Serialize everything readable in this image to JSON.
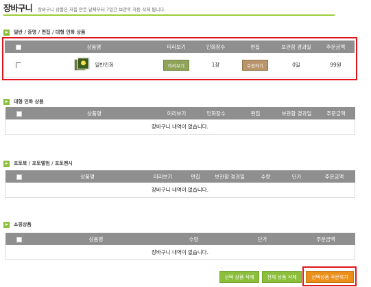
{
  "header": {
    "title": "장바구니",
    "description": "장바구니 상품은 처음 만든 날짜부터 7일간 보관후 자동 삭제 됩니다."
  },
  "colors": {
    "accent_green": "#8bbf3b",
    "table_header": "#8f8f8f",
    "highlight_red": "#e0141b",
    "order_orange": "#eb8f1b",
    "price_orange": "#e8862a"
  },
  "section1": {
    "title": "일반 / 증명 / 편집 / 대형 인화 상품",
    "columns": [
      "상품명",
      "미리보기",
      "인화장수",
      "편집",
      "보관함 경과일",
      "주문금액"
    ],
    "row": {
      "product_name": "일반인화",
      "thumbnail_icon": "photo-thumbnail-icon",
      "preview_label": "미리보기",
      "quantity": "1장",
      "edit_label": "수정하기",
      "elapsed_days": "0일",
      "amount": "99원"
    }
  },
  "section2": {
    "title": "대형 인화 상품",
    "columns": [
      "상품명",
      "미리보기",
      "인화장수",
      "편집",
      "보관함 경과일",
      "주문금액"
    ],
    "empty_message": "장바구니 내역이 없습니다."
  },
  "section3": {
    "title": "포토북 / 포토앨범 / 포토펜시",
    "columns": [
      "상품명",
      "미리보기",
      "편집",
      "보관함 경과일",
      "수량",
      "단가",
      "주문금액"
    ],
    "empty_message": "장바구니 내역이 없습니다."
  },
  "section4": {
    "title": "쇼핑상품",
    "columns": [
      "상품명",
      "수량",
      "단가",
      "주문금액"
    ],
    "empty_message": "장바구니 내역이 없습니다."
  },
  "buttons": {
    "delete_selected": "선택 상품 삭제",
    "delete_all": "전체 상품 삭제",
    "order_selected": "선택상품 주문하기"
  }
}
